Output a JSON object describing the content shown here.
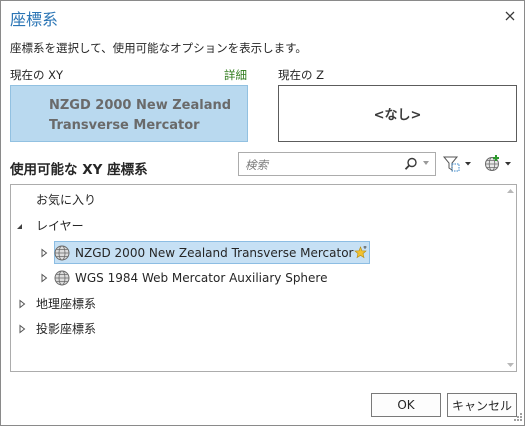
{
  "window": {
    "title": "座標系"
  },
  "description": "座標系を選択して、使用可能なオプションを表示します。",
  "current_xy": {
    "label": "現在の XY",
    "detail_link": "詳細",
    "line1": "NZGD 2000 New Zealand",
    "line2": "Transverse Mercator"
  },
  "current_z": {
    "label": "現在の Z",
    "value": "<なし>"
  },
  "available": {
    "heading": "使用可能な XY 座標系"
  },
  "search": {
    "placeholder": "検索"
  },
  "tree": {
    "favorites": "お気に入り",
    "layers": "レイヤー",
    "layer_items": [
      "NZGD 2000 New Zealand Transverse Mercator",
      "WGS 1984 Web Mercator Auxiliary Sphere"
    ],
    "geographic": "地理座標系",
    "projected": "投影座標系"
  },
  "buttons": {
    "ok": "OK",
    "cancel": "キャンセル"
  },
  "colors": {
    "accent": "#2b75b5",
    "selection": "#c6e0f4",
    "current_box": "#b9d9ef",
    "link": "#2d7a1a"
  }
}
